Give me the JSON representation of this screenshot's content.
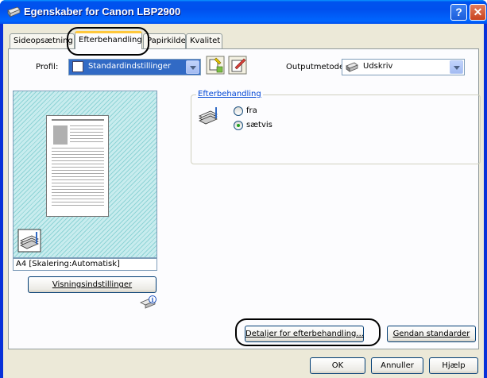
{
  "window": {
    "title": "Egenskaber for Canon LBP2900",
    "help_btn": "?",
    "close_btn": "✕"
  },
  "tabs": [
    {
      "label": "Sideopsætning",
      "active": false
    },
    {
      "label": "Efterbehandling",
      "active": true
    },
    {
      "label": "Papirkilde",
      "active": false
    },
    {
      "label": "Kvalitet",
      "active": false
    }
  ],
  "profile": {
    "label": "Profil:",
    "value": "Standardindstillinger"
  },
  "output_method": {
    "label": "Outputmetode:",
    "value": "Udskriv"
  },
  "preview": {
    "status": "A4 [Skalering:Automatisk]",
    "display_settings_button": "Visningsindstillinger"
  },
  "finishing_group": {
    "title": "Efterbehandling",
    "options": [
      {
        "label": "fra",
        "checked": false
      },
      {
        "label": "sætvis",
        "checked": true
      }
    ]
  },
  "buttons": {
    "details": "Detaljer for efterbehandling...",
    "restore_defaults": "Gendan standarder",
    "ok": "OK",
    "cancel": "Annuller",
    "help": "Hjælp"
  },
  "colors": {
    "titlebar": "#0054e3",
    "panel": "#fcfcfe",
    "dialog_bg": "#ece9d8",
    "active_tab_accent": "#ffc83c"
  }
}
